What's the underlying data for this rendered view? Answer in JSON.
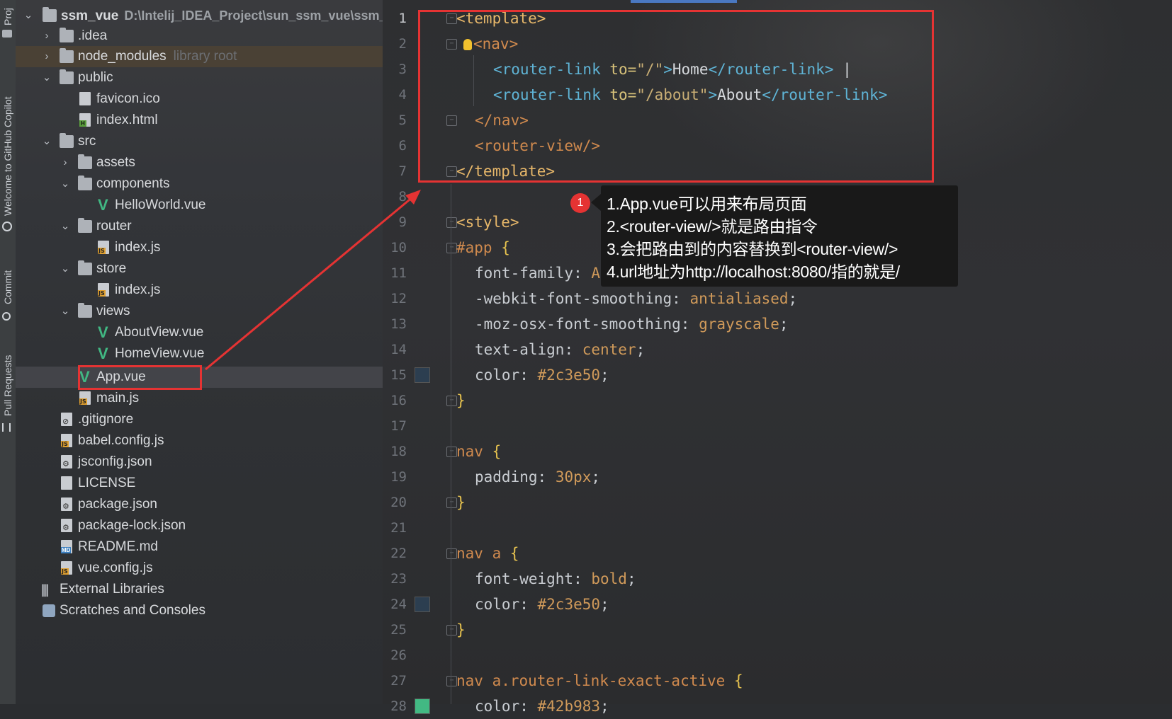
{
  "toolstrip": {
    "tabs": [
      {
        "label": "Proj",
        "icon": "folder-icon"
      },
      {
        "label": "Welcome to GitHub Copilot",
        "icon": "copilot-icon"
      },
      {
        "label": "Commit",
        "icon": "commit-icon"
      },
      {
        "label": "Pull Requests",
        "icon": "pull-request-icon"
      }
    ]
  },
  "project": {
    "root_name": "ssm_vue",
    "root_path": "D:\\Intelij_IDEA_Project\\sun_ssm_vue\\ssm_v",
    "items": [
      {
        "label": ".idea",
        "hint": ""
      },
      {
        "label": "node_modules",
        "hint": "library root"
      },
      {
        "label": "public",
        "hint": ""
      },
      {
        "label": "favicon.ico",
        "hint": ""
      },
      {
        "label": "index.html",
        "hint": ""
      },
      {
        "label": "src",
        "hint": ""
      },
      {
        "label": "assets",
        "hint": ""
      },
      {
        "label": "components",
        "hint": ""
      },
      {
        "label": "HelloWorld.vue",
        "hint": ""
      },
      {
        "label": "router",
        "hint": ""
      },
      {
        "label": "index.js",
        "hint": ""
      },
      {
        "label": "store",
        "hint": ""
      },
      {
        "label": "index.js",
        "hint": ""
      },
      {
        "label": "views",
        "hint": ""
      },
      {
        "label": "AboutView.vue",
        "hint": ""
      },
      {
        "label": "HomeView.vue",
        "hint": ""
      },
      {
        "label": "App.vue",
        "hint": ""
      },
      {
        "label": "main.js",
        "hint": ""
      },
      {
        "label": ".gitignore",
        "hint": ""
      },
      {
        "label": "babel.config.js",
        "hint": ""
      },
      {
        "label": "jsconfig.json",
        "hint": ""
      },
      {
        "label": "LICENSE",
        "hint": ""
      },
      {
        "label": "package.json",
        "hint": ""
      },
      {
        "label": "package-lock.json",
        "hint": ""
      },
      {
        "label": "README.md",
        "hint": ""
      },
      {
        "label": "vue.config.js",
        "hint": ""
      },
      {
        "label": "External Libraries",
        "hint": ""
      },
      {
        "label": "Scratches and Consoles",
        "hint": ""
      }
    ],
    "selected_file": "App.vue"
  },
  "editor": {
    "line_numbers": [
      "1",
      "2",
      "3",
      "4",
      "5",
      "6",
      "7",
      "8",
      "9",
      "10",
      "11",
      "12",
      "13",
      "14",
      "15",
      "16",
      "17",
      "18",
      "19",
      "20",
      "21",
      "22",
      "23",
      "24",
      "25",
      "26",
      "27",
      "28"
    ],
    "code": {
      "l1": [
        "<template>"
      ],
      "l2": [
        "<nav>"
      ],
      "l3": [
        "<router-link",
        " to=",
        "\"/\"",
        ">",
        "Home",
        "</router-link>",
        " |"
      ],
      "l4": [
        "<router-link",
        " to=",
        "\"/about\"",
        ">",
        "About",
        "</router-link>"
      ],
      "l5": [
        "</nav>"
      ],
      "l6": [
        "<router-view/>"
      ],
      "l7": [
        "</template>"
      ],
      "l9": [
        "<style>"
      ],
      "l10": [
        "#app",
        " {"
      ],
      "l11": [
        "font-family",
        ": ",
        "A"
      ],
      "l12": [
        "-webkit-font-smoothing",
        ": ",
        "antialiased",
        ";"
      ],
      "l13": [
        "-moz-osx-font-smoothing",
        ": ",
        "grayscale",
        ";"
      ],
      "l14": [
        "text-align",
        ": ",
        "center",
        ";"
      ],
      "l15": [
        "color",
        ": ",
        "#2c3e50",
        ";"
      ],
      "l16": [
        "}"
      ],
      "l18": [
        "nav",
        " {"
      ],
      "l19": [
        "padding",
        ": ",
        "30px",
        ";"
      ],
      "l20": [
        "}"
      ],
      "l22": [
        "nav a",
        " {"
      ],
      "l23": [
        "font-weight",
        ": ",
        "bold",
        ";"
      ],
      "l24": [
        "color",
        ": ",
        "#2c3e50",
        ";"
      ],
      "l25": [
        "}"
      ],
      "l27": [
        "nav a",
        ".router-link-exact-active",
        " {"
      ],
      "l28": [
        "color",
        ": ",
        "#42b983",
        ";"
      ]
    },
    "swatches": {
      "l15": "#2c3e50",
      "l24": "#2c3e50",
      "l28": "#42b983"
    }
  },
  "annotation": {
    "badge": "1",
    "lines": [
      "1.App.vue可以用来布局页面",
      "2.<router-view/>就是路由指令",
      "3.会把路由到的内容替换到<router-view/>",
      "4.url地址为http://localhost:8080/指的就是/"
    ],
    "color": "#e53333"
  }
}
